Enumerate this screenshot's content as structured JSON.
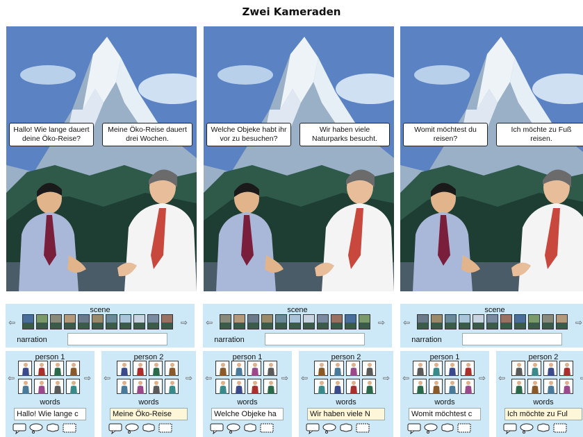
{
  "title": "Zwei Kameraden",
  "colors": {
    "sky": "#5b83c4",
    "panel_bg": "#cde9f8"
  },
  "panels": [
    {
      "left_bubble": "Hallo! Wie lange dauert deine Öko-Reise?",
      "right_bubble": "Meine Öko-Reise dauert drei Wochen."
    },
    {
      "left_bubble": "Welche Objeke habt ihr vor zu besuchen?",
      "right_bubble": "Wir haben viele Naturparks besucht."
    },
    {
      "left_bubble": "Womit möchtest du reisen?",
      "right_bubble": "Ich möchte zu Fuß reisen."
    }
  ],
  "controls": [
    {
      "scene_label": "scene",
      "narration_label": "narration",
      "narration_value": "",
      "person1_label": "person 1",
      "person2_label": "person 2",
      "words_label": "words",
      "words1": "Hallo! Wie lange c",
      "words2": "Meine  Öko-Reise"
    },
    {
      "scene_label": "scene",
      "narration_label": "narration",
      "narration_value": "",
      "person1_label": "person 1",
      "person2_label": "person 2",
      "words_label": "words",
      "words1": "Welche Objeke ha",
      "words2": "Wir haben viele N"
    },
    {
      "scene_label": "scene",
      "narration_label": "narration",
      "narration_value": "",
      "person1_label": "person 1",
      "person2_label": "person 2",
      "words_label": "words",
      "words1": "Womit möchtest c",
      "words2": "Ich möchte zu Ful"
    }
  ],
  "arrows": {
    "left": "⇦",
    "right": "⇨"
  }
}
